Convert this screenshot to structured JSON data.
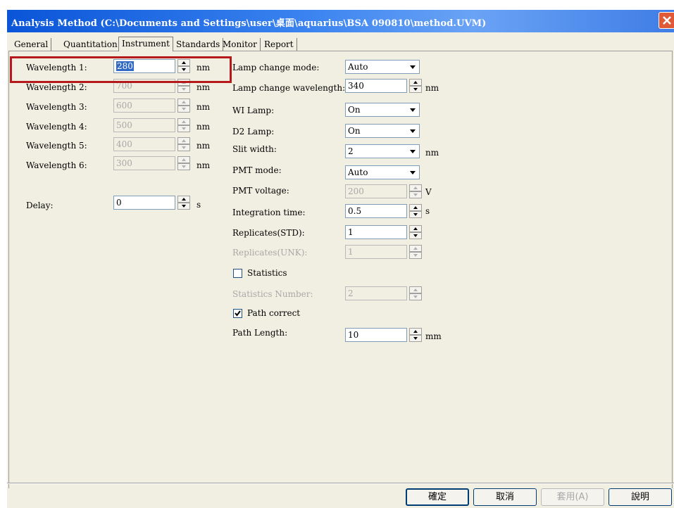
{
  "window": {
    "title": "Analysis Method (C:\\Documents and Settings\\user\\桌面\\aquarius\\BSA 090810\\method.UVM)"
  },
  "tabs": [
    {
      "label": "General",
      "active": false
    },
    {
      "label": "Quantitation",
      "active": false
    },
    {
      "label": "Instrument",
      "active": true
    },
    {
      "label": "Standards",
      "active": false
    },
    {
      "label": "Monitor",
      "active": false
    },
    {
      "label": "Report",
      "active": false
    }
  ],
  "left": {
    "wavelengths": [
      {
        "label": "Wavelength 1:",
        "value": "280",
        "unit": "nm",
        "enabled": true
      },
      {
        "label": "Wavelength 2:",
        "value": "700",
        "unit": "nm",
        "enabled": false
      },
      {
        "label": "Wavelength 3:",
        "value": "600",
        "unit": "nm",
        "enabled": false
      },
      {
        "label": "Wavelength 4:",
        "value": "500",
        "unit": "nm",
        "enabled": false
      },
      {
        "label": "Wavelength 5:",
        "value": "400",
        "unit": "nm",
        "enabled": false
      },
      {
        "label": "Wavelength 6:",
        "value": "300",
        "unit": "nm",
        "enabled": false
      }
    ],
    "delay": {
      "label": "Delay:",
      "value": "0",
      "unit": "s"
    }
  },
  "right": {
    "lamp_change_mode": {
      "label": "Lamp change mode:",
      "value": "Auto"
    },
    "lamp_change_wavelength": {
      "label": "Lamp change wavelength:",
      "value": "340",
      "unit": "nm"
    },
    "wi_lamp": {
      "label": "WI Lamp:",
      "value": "On"
    },
    "d2_lamp": {
      "label": "D2 Lamp:",
      "value": "On"
    },
    "slit_width": {
      "label": "Slit width:",
      "value": "2",
      "unit": "nm"
    },
    "pmt_mode": {
      "label": "PMT mode:",
      "value": "Auto"
    },
    "pmt_voltage": {
      "label": "PMT voltage:",
      "value": "200",
      "unit": "V"
    },
    "integration_time": {
      "label": "Integration time:",
      "value": "0.5",
      "unit": "s"
    },
    "replicates_std": {
      "label": "Replicates(STD):",
      "value": "1"
    },
    "replicates_unk": {
      "label": "Replicates(UNK):",
      "value": "1"
    },
    "statistics": {
      "label": "Statistics",
      "checked": false
    },
    "statistics_number": {
      "label": "Statistics Number:",
      "value": "2"
    },
    "path_correct": {
      "label": "Path correct",
      "checked": true
    },
    "path_length": {
      "label": "Path Length:",
      "value": "10",
      "unit": "mm"
    }
  },
  "buttons": {
    "ok": "確定",
    "cancel": "取消",
    "apply": "套用(A)",
    "help": "說明"
  },
  "colors": {
    "titlebar": "#0a55d8",
    "highlight_box": "#b5191b",
    "selection": "#316ac5"
  }
}
